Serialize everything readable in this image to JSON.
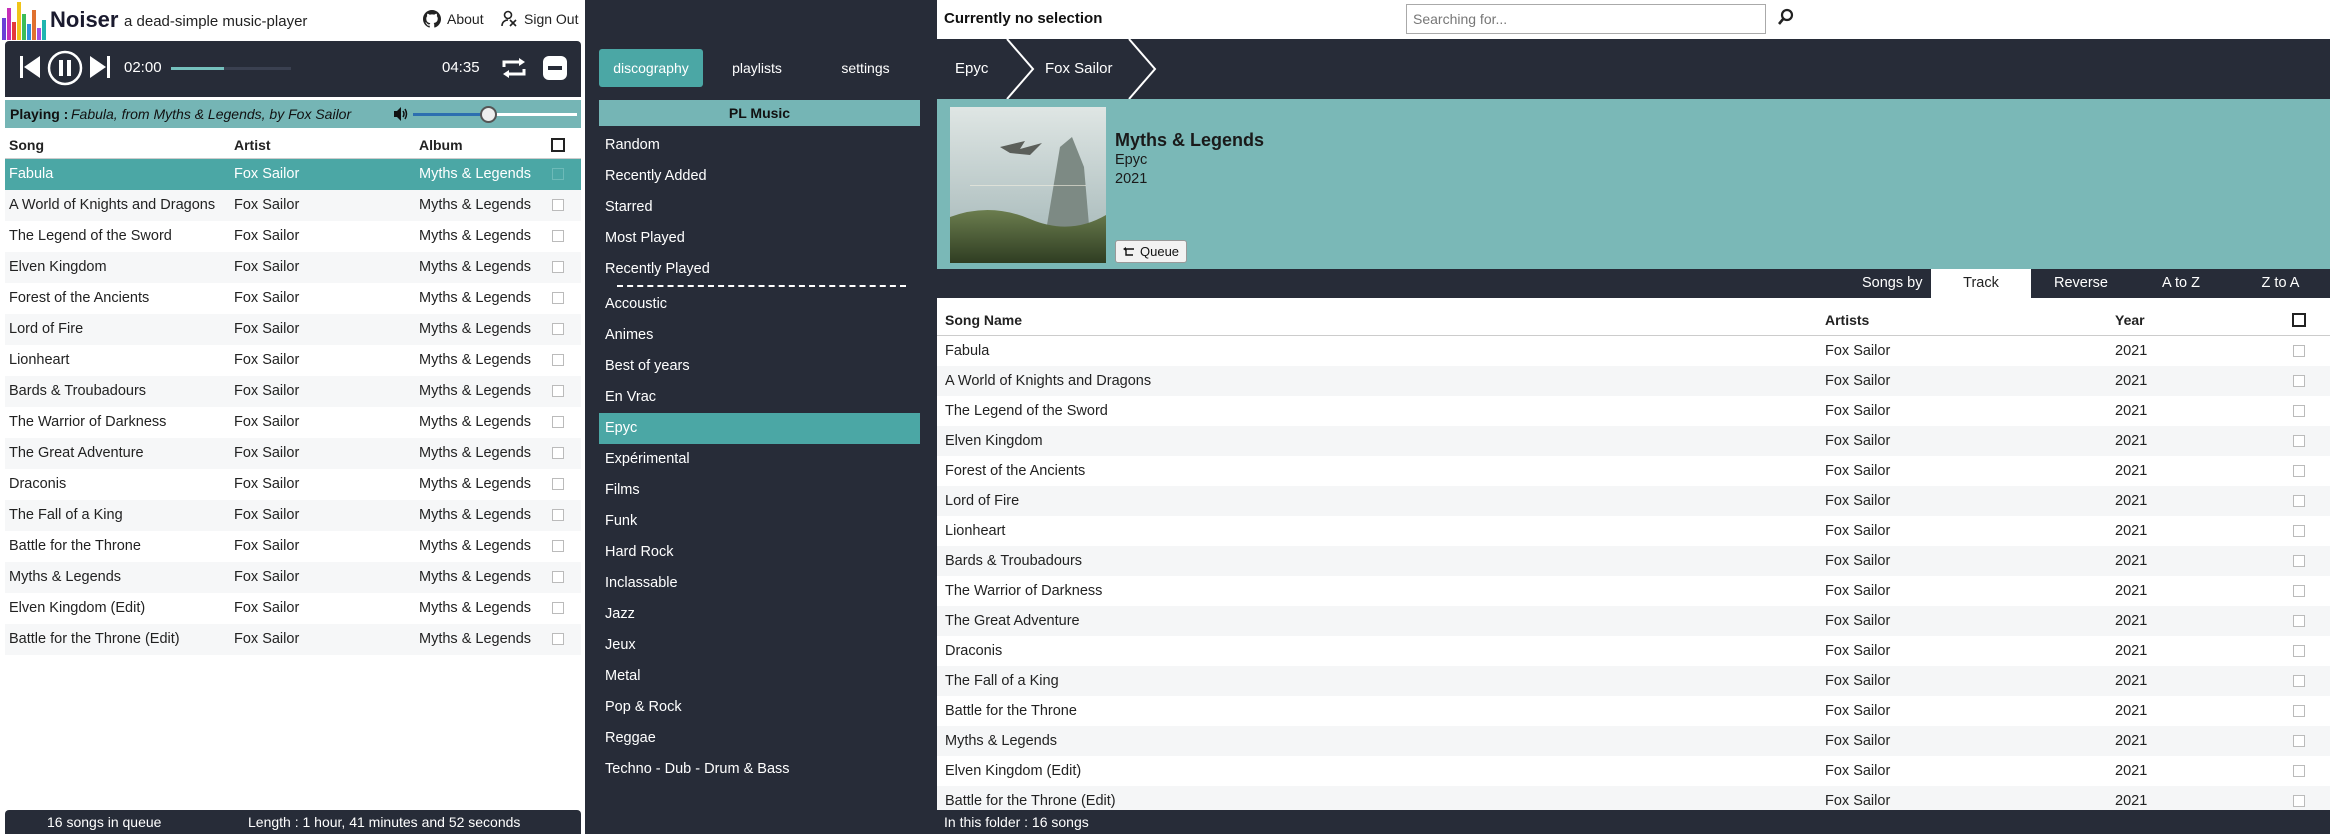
{
  "app": {
    "name": "Noiser",
    "tagline": "a dead-simple music-player",
    "about_label": "About",
    "signout_label": "Sign Out",
    "accent_color": "#4ba7a5",
    "dark_color": "#272c38"
  },
  "player": {
    "time_current": "02:00",
    "time_total": "04:35",
    "progress_fraction": 0.44,
    "volume_fraction": 0.46,
    "playing_label": "Playing :",
    "playing_text": "Fabula, from Myths & Legends, by Fox Sailor",
    "icons": [
      "previous-icon",
      "pause-icon",
      "next-icon",
      "repeat-icon",
      "stop-icon",
      "volume-icon"
    ]
  },
  "queue": {
    "columns": [
      "Song",
      "Artist",
      "Album"
    ],
    "active_index": 0,
    "rows": [
      {
        "song": "Fabula",
        "artist": "Fox Sailor",
        "album": "Myths & Legends"
      },
      {
        "song": "A World of Knights and Dragons",
        "artist": "Fox Sailor",
        "album": "Myths & Legends"
      },
      {
        "song": "The Legend of the Sword",
        "artist": "Fox Sailor",
        "album": "Myths & Legends"
      },
      {
        "song": "Elven Kingdom",
        "artist": "Fox Sailor",
        "album": "Myths & Legends"
      },
      {
        "song": "Forest of the Ancients",
        "artist": "Fox Sailor",
        "album": "Myths & Legends"
      },
      {
        "song": "Lord of Fire",
        "artist": "Fox Sailor",
        "album": "Myths & Legends"
      },
      {
        "song": "Lionheart",
        "artist": "Fox Sailor",
        "album": "Myths & Legends"
      },
      {
        "song": "Bards & Troubadours",
        "artist": "Fox Sailor",
        "album": "Myths & Legends"
      },
      {
        "song": "The Warrior of Darkness",
        "artist": "Fox Sailor",
        "album": "Myths & Legends"
      },
      {
        "song": "The Great Adventure",
        "artist": "Fox Sailor",
        "album": "Myths & Legends"
      },
      {
        "song": "Draconis",
        "artist": "Fox Sailor",
        "album": "Myths & Legends"
      },
      {
        "song": "The Fall of a King",
        "artist": "Fox Sailor",
        "album": "Myths & Legends"
      },
      {
        "song": "Battle for the Throne",
        "artist": "Fox Sailor",
        "album": "Myths & Legends"
      },
      {
        "song": "Myths & Legends",
        "artist": "Fox Sailor",
        "album": "Myths & Legends"
      },
      {
        "song": "Elven Kingdom (Edit)",
        "artist": "Fox Sailor",
        "album": "Myths & Legends"
      },
      {
        "song": "Battle for the Throne (Edit)",
        "artist": "Fox Sailor",
        "album": "Myths & Legends"
      }
    ],
    "footer_count": "16 songs in queue",
    "footer_length": "Length :  1 hour, 41 minutes and  52 seconds"
  },
  "library": {
    "tabs": [
      "discography",
      "playlists",
      "settings"
    ],
    "active_tab": 0,
    "header": "PL Music",
    "smart_lists": [
      "Random",
      "Recently Added",
      "Starred",
      "Most Played",
      "Recently Played"
    ],
    "folders": [
      "Accoustic",
      "Animes",
      "Best of years",
      "En Vrac",
      "Epyc",
      "Expérimental",
      "Films",
      "Funk",
      "Hard Rock",
      "Inclassable",
      "Jazz",
      "Jeux",
      "Metal",
      "Pop & Rock",
      "Reggae",
      "Techno - Dub - Drum & Bass"
    ],
    "active_folder": "Epyc"
  },
  "browser": {
    "selection_label": "Currently no selection",
    "search_placeholder": "Searching for...",
    "breadcrumbs": [
      "Epyc",
      "Fox Sailor"
    ],
    "album": {
      "title": "Myths & Legends",
      "artist": "Epyc",
      "year": "2021",
      "queue_label": "Queue"
    },
    "sort_label": "Songs by",
    "sort_options": [
      "Track",
      "Reverse",
      "A to Z",
      "Z to A"
    ],
    "active_sort": 0,
    "columns": [
      "Song Name",
      "Artists",
      "Year"
    ],
    "songs": [
      {
        "name": "Fabula",
        "artist": "Fox Sailor",
        "year": "2021"
      },
      {
        "name": "A World of Knights and Dragons",
        "artist": "Fox Sailor",
        "year": "2021"
      },
      {
        "name": "The Legend of the Sword",
        "artist": "Fox Sailor",
        "year": "2021"
      },
      {
        "name": "Elven Kingdom",
        "artist": "Fox Sailor",
        "year": "2021"
      },
      {
        "name": "Forest of the Ancients",
        "artist": "Fox Sailor",
        "year": "2021"
      },
      {
        "name": "Lord of Fire",
        "artist": "Fox Sailor",
        "year": "2021"
      },
      {
        "name": "Lionheart",
        "artist": "Fox Sailor",
        "year": "2021"
      },
      {
        "name": "Bards & Troubadours",
        "artist": "Fox Sailor",
        "year": "2021"
      },
      {
        "name": "The Warrior of Darkness",
        "artist": "Fox Sailor",
        "year": "2021"
      },
      {
        "name": "The Great Adventure",
        "artist": "Fox Sailor",
        "year": "2021"
      },
      {
        "name": "Draconis",
        "artist": "Fox Sailor",
        "year": "2021"
      },
      {
        "name": "The Fall of a King",
        "artist": "Fox Sailor",
        "year": "2021"
      },
      {
        "name": "Battle for the Throne",
        "artist": "Fox Sailor",
        "year": "2021"
      },
      {
        "name": "Myths & Legends",
        "artist": "Fox Sailor",
        "year": "2021"
      },
      {
        "name": "Elven Kingdom (Edit)",
        "artist": "Fox Sailor",
        "year": "2021"
      },
      {
        "name": "Battle for the Throne (Edit)",
        "artist": "Fox Sailor",
        "year": "2021"
      }
    ],
    "footer_text": "In this folder : 16 songs"
  }
}
